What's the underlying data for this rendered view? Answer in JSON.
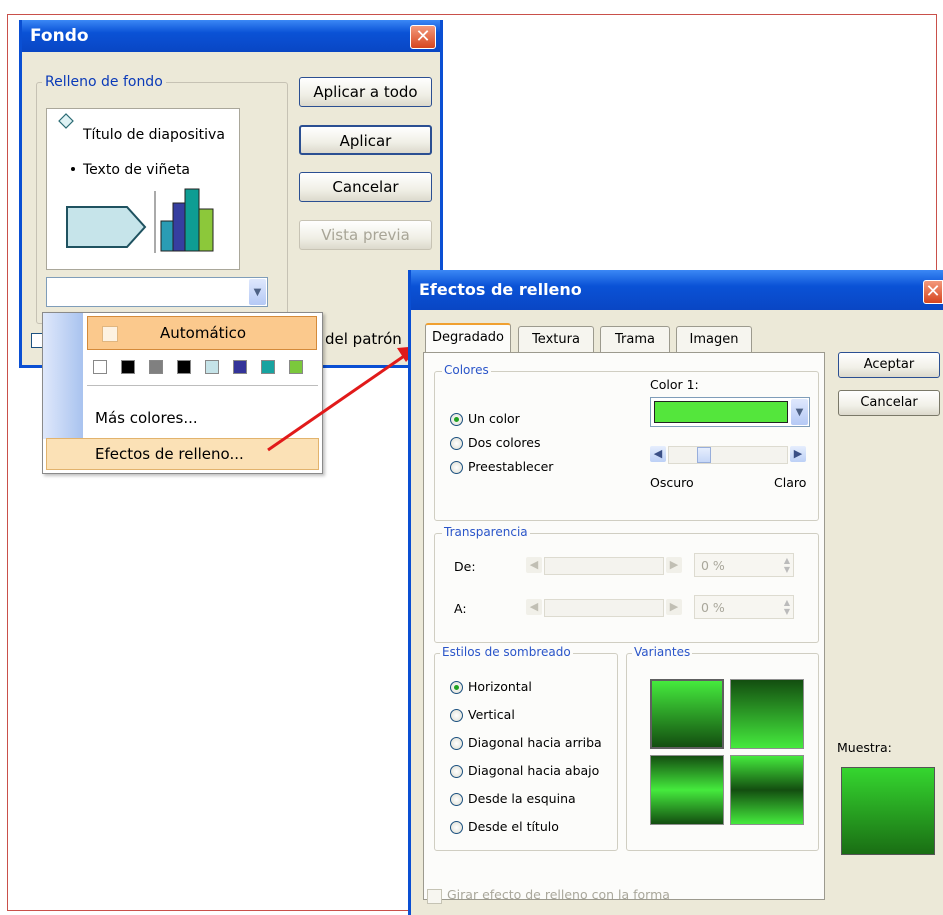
{
  "fondo": {
    "title": "Fondo",
    "group_label": "Relleno de fondo",
    "preview": {
      "title_text": "Título de diapositiva",
      "bullet_text": "Texto de viñeta"
    },
    "buttons": {
      "apply_all": "Aplicar a todo",
      "apply": "Aplicar",
      "cancel": "Cancelar",
      "preview": "Vista previa"
    },
    "omit_text": "del patrón"
  },
  "color_menu": {
    "automatic": "Automático",
    "swatches": [
      "#ffffff",
      "#000000",
      "#808080",
      "#000000",
      "#c5e3e8",
      "#333399",
      "#17a3a0",
      "#7bc83c"
    ],
    "more_colors": "Más colores...",
    "fill_effects": "Efectos de relleno..."
  },
  "efectos": {
    "title": "Efectos de relleno",
    "tabs": [
      "Degradado",
      "Textura",
      "Trama",
      "Imagen"
    ],
    "buttons": {
      "ok": "Aceptar",
      "cancel": "Cancelar"
    },
    "colores": {
      "label": "Colores",
      "options": [
        "Un color",
        "Dos colores",
        "Preestablecer"
      ],
      "selected": "Un color",
      "color1_label": "Color 1:",
      "color1_value": "#54e63c",
      "dark_label": "Oscuro",
      "light_label": "Claro"
    },
    "transparencia": {
      "label": "Transparencia",
      "from_label": "De:",
      "to_label": "A:",
      "from_value": "0 %",
      "to_value": "0 %"
    },
    "estilos": {
      "label": "Estilos de sombreado",
      "options": [
        "Horizontal",
        "Vertical",
        "Diagonal hacia arriba",
        "Diagonal hacia abajo",
        "Desde la esquina",
        "Desde el título"
      ],
      "selected": "Horizontal"
    },
    "variantes_label": "Variantes",
    "sample_label": "Muestra:",
    "rotate_label": "Girar efecto de relleno con la forma"
  }
}
